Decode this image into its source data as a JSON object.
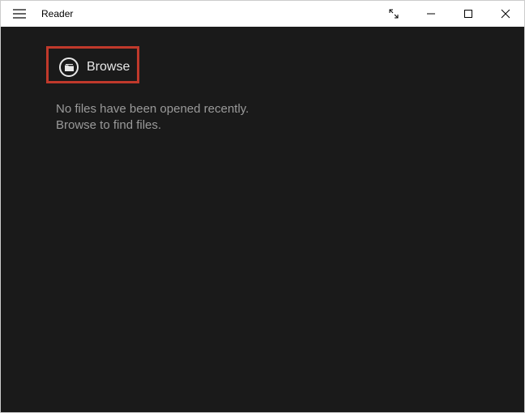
{
  "titlebar": {
    "app_title": "Reader"
  },
  "main": {
    "browse_label": "Browse",
    "empty_line1": "No files have been opened recently.",
    "empty_line2": "Browse to find files."
  }
}
